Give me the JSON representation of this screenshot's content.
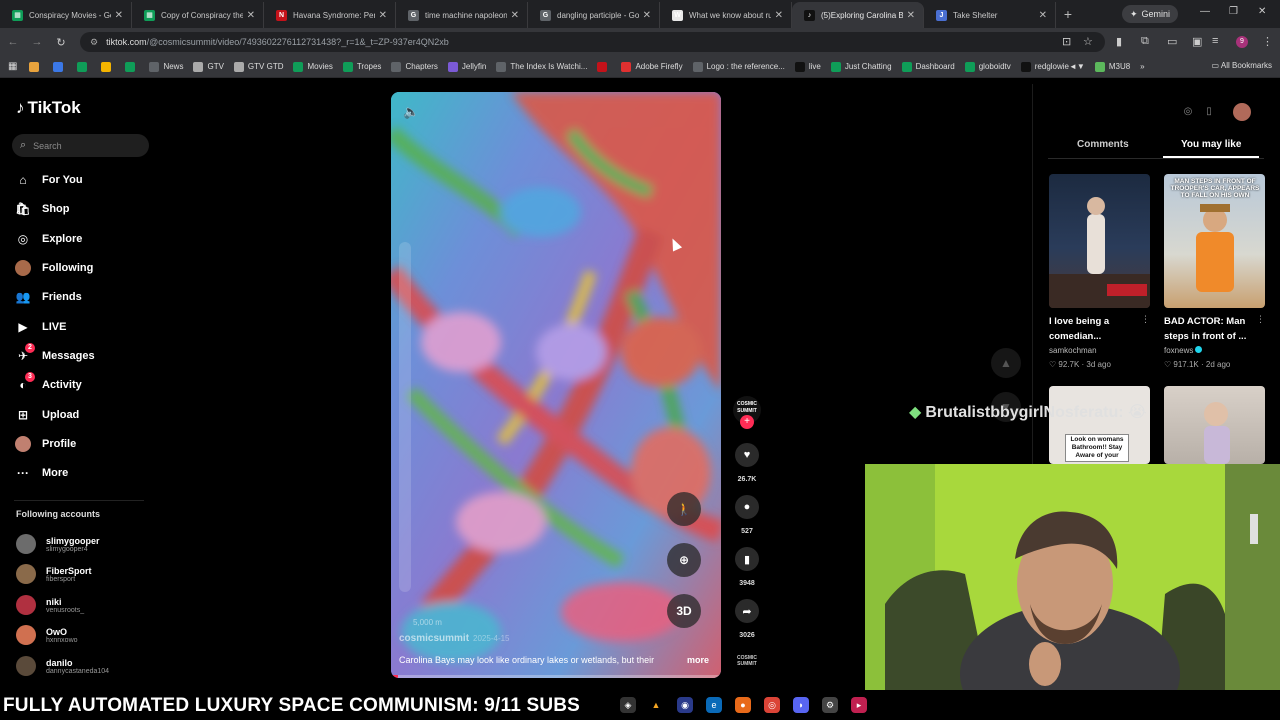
{
  "browser": {
    "tabs": [
      {
        "title": "Conspiracy Movies - Go",
        "favicon_color": "#0f9d58",
        "favicon": "▦",
        "active": false
      },
      {
        "title": "Copy of Conspiracy the",
        "favicon_color": "#0f9d58",
        "favicon": "▦",
        "active": false
      },
      {
        "title": "Havana Syndrome: Pent",
        "favicon_color": "#c4121a",
        "favicon": "N",
        "active": false
      },
      {
        "title": "time machine napoleon",
        "favicon_color": "#5f6368",
        "favicon": "G",
        "active": false
      },
      {
        "title": "dangling participle - Go",
        "favicon_color": "#5f6368",
        "favicon": "G",
        "active": false
      },
      {
        "title": "What we know about ru",
        "favicon_color": "#e8e8e8",
        "favicon": "W",
        "active": false
      },
      {
        "title": "(5)Exploring Carolina B",
        "favicon_color": "#111111",
        "favicon": "♪",
        "active": true
      },
      {
        "title": "Take Shelter",
        "favicon_color": "#4a6fd1",
        "favicon": "J",
        "active": false
      }
    ],
    "gemini_label": "Gemini",
    "address": {
      "host": "tiktok.com",
      "path": "/@cosmicsummit/video/7493602276112731438?_r=1&_t=ZP-937er4QN2xb"
    },
    "profile_initial": "9",
    "bookmarks": [
      {
        "label": "",
        "color": "#e8a33d"
      },
      {
        "label": "",
        "color": "#3b78e7"
      },
      {
        "label": "",
        "color": "#0f9d58"
      },
      {
        "label": "",
        "color": "#f4b400"
      },
      {
        "label": "",
        "color": "#0f9d58"
      },
      {
        "label": "News",
        "color": "#5f6368"
      },
      {
        "label": "GTV",
        "color": "#aaaaaa"
      },
      {
        "label": "GTV GTD",
        "color": "#aaaaaa"
      },
      {
        "label": "Movies",
        "color": "#0f9d58"
      },
      {
        "label": "Tropes",
        "color": "#0f9d58"
      },
      {
        "label": "Chapters",
        "color": "#5f6368"
      },
      {
        "label": "Jellyfin",
        "color": "#7b5ad6"
      },
      {
        "label": "The Index Is Watchi...",
        "color": "#5f6368"
      },
      {
        "label": "",
        "color": "#c4121a"
      },
      {
        "label": "Adobe Firefly",
        "color": "#e03030"
      },
      {
        "label": "Logo : the reference...",
        "color": "#5f6368"
      },
      {
        "label": "live",
        "color": "#111111"
      },
      {
        "label": "Just Chatting",
        "color": "#0f9d58"
      },
      {
        "label": "Dashboard",
        "color": "#0f9d58"
      },
      {
        "label": "globoidtv",
        "color": "#0f9d58"
      },
      {
        "label": "redglowie◄▼",
        "color": "#111111"
      },
      {
        "label": "M3U8",
        "color": "#5cb85c"
      }
    ],
    "all_bookmarks_label": "All Bookmarks"
  },
  "tiktok": {
    "logo": "TikTok",
    "search_placeholder": "Search",
    "nav": [
      {
        "label": "For You",
        "icon": "home-icon",
        "glyph": "⌂",
        "badge": ""
      },
      {
        "label": "Shop",
        "icon": "shop-icon",
        "glyph": "🛍",
        "badge": ""
      },
      {
        "label": "Explore",
        "icon": "compass-icon",
        "glyph": "◎",
        "badge": ""
      },
      {
        "label": "Following",
        "icon": "avatar",
        "glyph": "",
        "badge": ""
      },
      {
        "label": "Friends",
        "icon": "friends-icon",
        "glyph": "👥",
        "badge": ""
      },
      {
        "label": "LIVE",
        "icon": "live-icon",
        "glyph": "▶",
        "badge": ""
      },
      {
        "label": "Messages",
        "icon": "messages-icon",
        "glyph": "✈",
        "badge": "2"
      },
      {
        "label": "Activity",
        "icon": "activity-icon",
        "glyph": "◐",
        "badge": "3"
      },
      {
        "label": "Upload",
        "icon": "upload-icon",
        "glyph": "⊞",
        "badge": ""
      },
      {
        "label": "Profile",
        "icon": "avatar",
        "glyph": "",
        "badge": ""
      },
      {
        "label": "More",
        "icon": "more-icon",
        "glyph": "···",
        "badge": ""
      }
    ],
    "following_title": "Following accounts",
    "following": [
      {
        "name": "slimygooper",
        "handle": "slimygooper4",
        "color": "#6c6c6c"
      },
      {
        "name": "FiberSport",
        "handle": "fibersport",
        "color": "#8a6a4a"
      },
      {
        "name": "niki",
        "handle": "venusroots_",
        "color": "#b03040"
      },
      {
        "name": "OwO",
        "handle": "hxnnxowo",
        "color": "#d07050"
      },
      {
        "name": "danilo",
        "handle": "dannycastaneda104",
        "color": "#5a4a3a"
      }
    ],
    "video": {
      "scale_label": "5,000 m",
      "author": "cosmicsummit",
      "date": "2025-4-15",
      "caption": "Carolina Bays may look like ordinary lakes or wetlands, but their",
      "more_label": "more",
      "btn_3d": "3D",
      "progress": 0.02
    },
    "actions": {
      "creator_badge": "COSMIC SUMMIT",
      "likes": "26.7K",
      "comments": "527",
      "saves": "3948",
      "shares": "3026"
    },
    "panel": {
      "tab_comments": "Comments",
      "tab_you_may_like": "You may like",
      "cards": [
        {
          "title": "I love being a comedian...",
          "author": "samkochman",
          "verified": false,
          "likes": "92.7K",
          "age": "3d ago"
        },
        {
          "title": "BAD ACTOR: Man steps in front of ...",
          "author": "foxnews",
          "verified": true,
          "likes": "917.1K",
          "age": "2d ago"
        }
      ],
      "thumb2_text": "MAN STEPS IN FRONT OF TROOPER'S CAR, APPEARS TO FALL ON HIS OWN",
      "thumb3_text": "Look on womans Bathroom!! Stay Aware of your"
    }
  },
  "stream": {
    "chat_message": "BrutalistbbygirlNosferatu:",
    "chat_emoji": "😭",
    "ticker": "FULLY AUTOMATED LUXURY SPACE COMMUNISM: 9/11 SUBS"
  }
}
